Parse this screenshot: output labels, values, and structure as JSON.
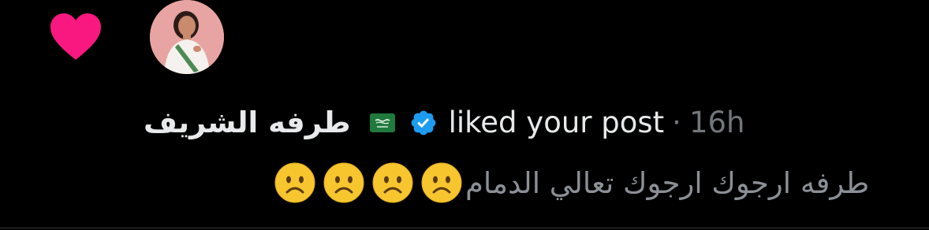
{
  "notification": {
    "type_icon": "heart-icon",
    "username": "طرفه الشريف",
    "flag": "saudi-flag-emoji",
    "verified_icon": "verified-badge-icon",
    "action": "liked your post",
    "separator": "·",
    "time": "16h",
    "post_text": "طرفه ارجوك ارجوك تعالي الدمام",
    "post_emoji_name": "frowning-face-emoji"
  },
  "colors": {
    "background": "#000000",
    "heart": "#f91880",
    "verified": "#1d9bf0",
    "primary_text": "#e7e9ea",
    "secondary_text": "#71767b",
    "post_text": "#8b9096"
  }
}
